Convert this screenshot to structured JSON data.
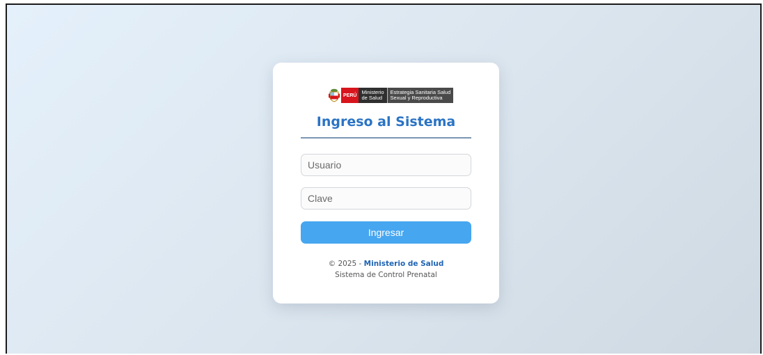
{
  "logo": {
    "peru": "PERÚ",
    "minsa_line1": "Ministerio",
    "minsa_line2": "de Salud",
    "strategy_line1": "Estrategia Sanitaria Salud",
    "strategy_line2": "Sexual y Reproductiva"
  },
  "title": "Ingreso al Sistema",
  "form": {
    "user_placeholder": "Usuario",
    "user_value": "",
    "password_placeholder": "Clave",
    "password_value": "",
    "submit_label": "Ingresar"
  },
  "footer": {
    "copyright": "© 2025 - ",
    "org_link": "Ministerio de Salud",
    "system_name": "Sistema de Control Prenatal"
  },
  "colors": {
    "accent": "#2a73c4",
    "button": "#46a6f0",
    "logo_red": "#d8141c"
  }
}
